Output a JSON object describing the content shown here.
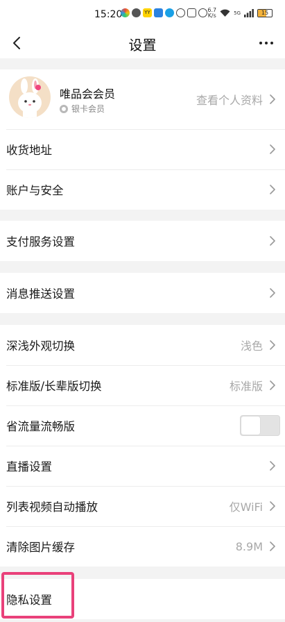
{
  "status_bar": {
    "time": "15:20",
    "app_badge": "YY",
    "network_speed_value": "6.7",
    "network_speed_unit": "K/s",
    "network_type": "5G",
    "battery": "15"
  },
  "header": {
    "title": "设置"
  },
  "profile": {
    "name": "唯品会会员",
    "member_level": "银卡会员",
    "view_profile_label": "查看个人资料"
  },
  "account_rows": [
    {
      "label": "收货地址"
    },
    {
      "label": "账户与安全"
    }
  ],
  "payment_row": {
    "label": "支付服务设置"
  },
  "message_row": {
    "label": "消息推送设置"
  },
  "preference_rows": [
    {
      "label": "深浅外观切换",
      "value": "浅色"
    },
    {
      "label": "标准版/长辈版切换",
      "value": "标准版"
    },
    {
      "label": "省流量流畅版",
      "toggle": false
    },
    {
      "label": "直播设置"
    },
    {
      "label": "列表视频自动播放",
      "value": "仅WiFi"
    },
    {
      "label": "清除图片缓存",
      "value": "8.9M"
    }
  ],
  "privacy_row": {
    "label": "隐私设置"
  },
  "colors": {
    "highlight": "#e9417a",
    "secondary_text": "#a8a8a8",
    "background": "#f3f3f3"
  }
}
